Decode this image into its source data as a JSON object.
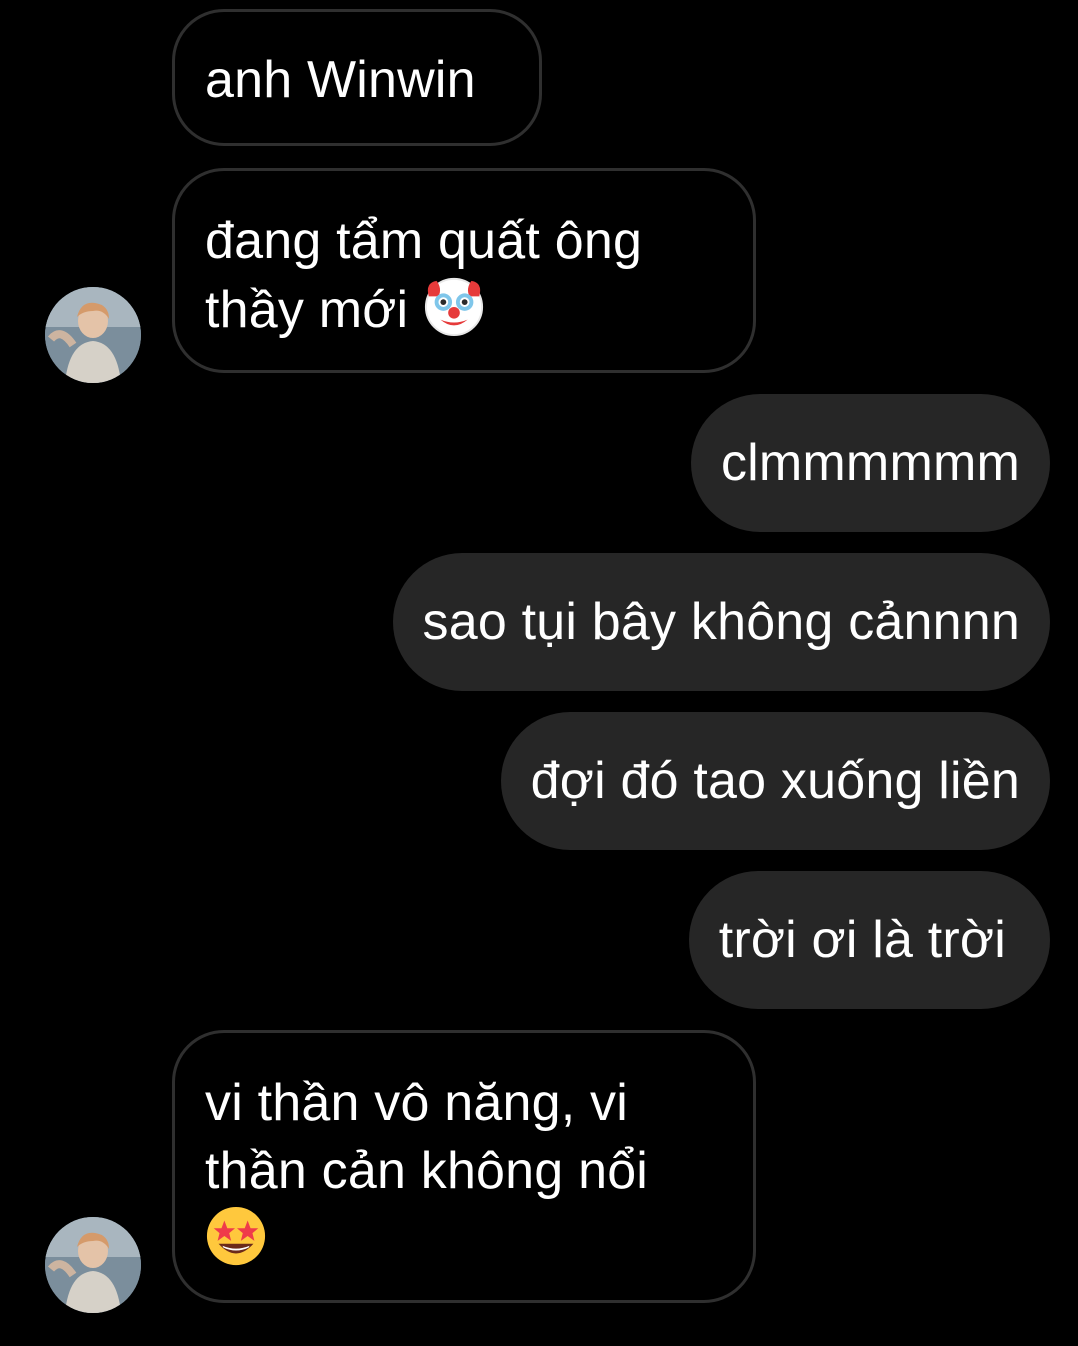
{
  "messages": [
    {
      "text": "anh Winwin"
    },
    {
      "line1": "đang tẩm quất ông",
      "line2": "thầy mới",
      "emoji": "clown-face-icon"
    },
    {
      "text": "clmmmmmm"
    },
    {
      "text": "sao tụi bây không cảnnnn"
    },
    {
      "text": "đợi đó tao xuống liền"
    },
    {
      "text": "trời ơi là trời"
    },
    {
      "line1": "vi thần vô năng, vi",
      "line2": "thần cản không nổi",
      "emoji": "star-struck-face-icon"
    }
  ],
  "colors": {
    "background": "#000000",
    "incoming_border": "#2f2f2f",
    "outgoing_bubble": "#262626",
    "text": "#ffffff"
  }
}
